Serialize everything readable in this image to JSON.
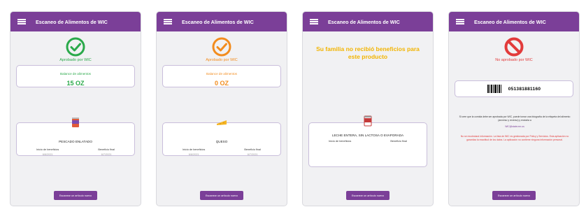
{
  "app": {
    "title": "Escaneo de Alimentos de WIC"
  },
  "colors": {
    "brand": "#7b3f98",
    "approved": "#2aa94a",
    "warning": "#f28c1e",
    "no_benefit": "#f2b400",
    "denied": "#e23b3b"
  },
  "screens": [
    {
      "status_icon": "check-circle-icon",
      "status_label": "Aprobado por WIC",
      "balance_label": "Balance de alimentos",
      "balance_value": "15 OZ",
      "food_icon": "canned-fish-icon",
      "food_name": "PESCADO ENLATADO",
      "start_label": "Inicio de beneficios",
      "start_date": "6/6/2021",
      "end_label": "Beneficio final",
      "end_date": "6/7/2021",
      "scan_button": "Escanear un artículo nuevo"
    },
    {
      "status_icon": "check-circle-icon",
      "status_label": "Aprobado por WIC",
      "balance_label": "Balance de alimentos",
      "balance_value": "0 OZ",
      "food_icon": "cheese-icon",
      "food_name": "QUESO",
      "start_label": "Inicio de beneficios",
      "start_date": "6/6/2021",
      "end_label": "Beneficio final",
      "end_date": "6/7/2021",
      "scan_button": "Escanear un artículo nuevo"
    },
    {
      "message": "Su familia no recibió beneficios para este producto",
      "food_icon": "milk-can-icon",
      "food_name": "LECHE ENTERA, SIN LACTOSA O EVAPORADA",
      "start_label": "Inicio de beneficios",
      "end_label": "Beneficio final",
      "scan_button": "Escanear un artículo nuevo"
    },
    {
      "status_icon": "prohibited-icon",
      "status_label": "No aprobado por WIC",
      "upc": "051381881160",
      "info_text": "Si cree que la comida debe ser aprobada por WIC, puede tomar una fotografía de la etiqueta del alimento (anverso y reverso) y enviarla a",
      "info_link": "WIC@state.mn.us",
      "disclaimer": "No se recolectará información. La lista de WIC es gestionada por Policy y Servicios. Esta aplicación no garantiza la exactitud de los datos. La aplicación no contiene ninguna información personal.",
      "scan_button": "Escanear un artículo nuevo"
    }
  ]
}
